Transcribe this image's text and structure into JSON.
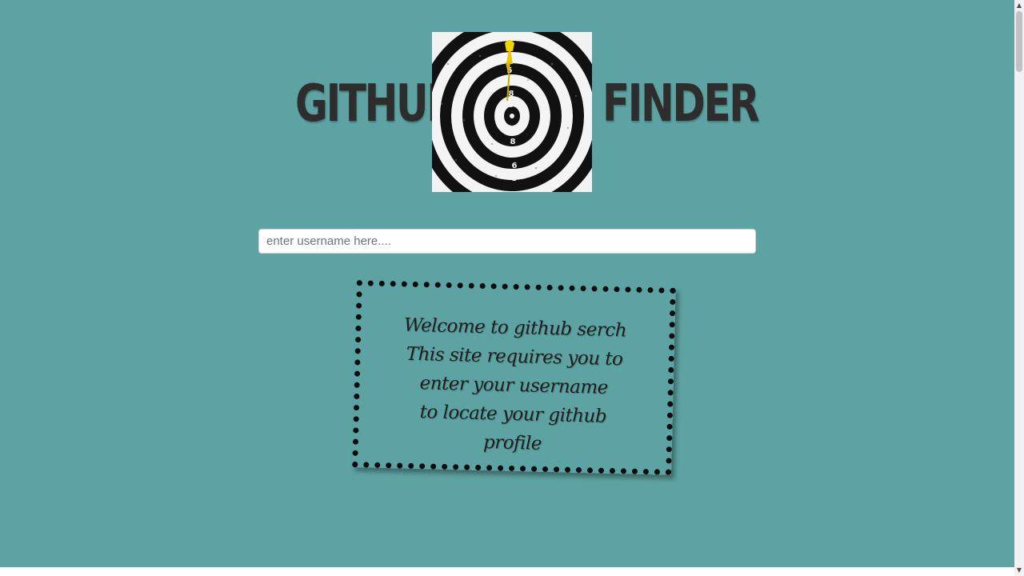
{
  "header": {
    "title_left": "GITHUB",
    "title_right": "FINDER",
    "logo": {
      "icon": "dartboard-logo-icon",
      "visible_numbers": [
        "3",
        "5",
        "7",
        "8",
        "9",
        "9",
        "8",
        "7",
        "6",
        "5"
      ]
    }
  },
  "search": {
    "placeholder": "enter username here....",
    "value": ""
  },
  "welcome": {
    "lines": [
      "Welcome to github serch",
      "This site requires you to",
      "enter your username",
      "to locate your github",
      "profile"
    ]
  },
  "colors": {
    "background": "#5ea3a3",
    "title": "#2d2d2d",
    "border": "#0d0d0d",
    "dart": "#e8c900"
  },
  "scrollbar": {
    "up_icon": "scroll-up-arrow-icon",
    "down_icon": "scroll-down-arrow-icon"
  }
}
